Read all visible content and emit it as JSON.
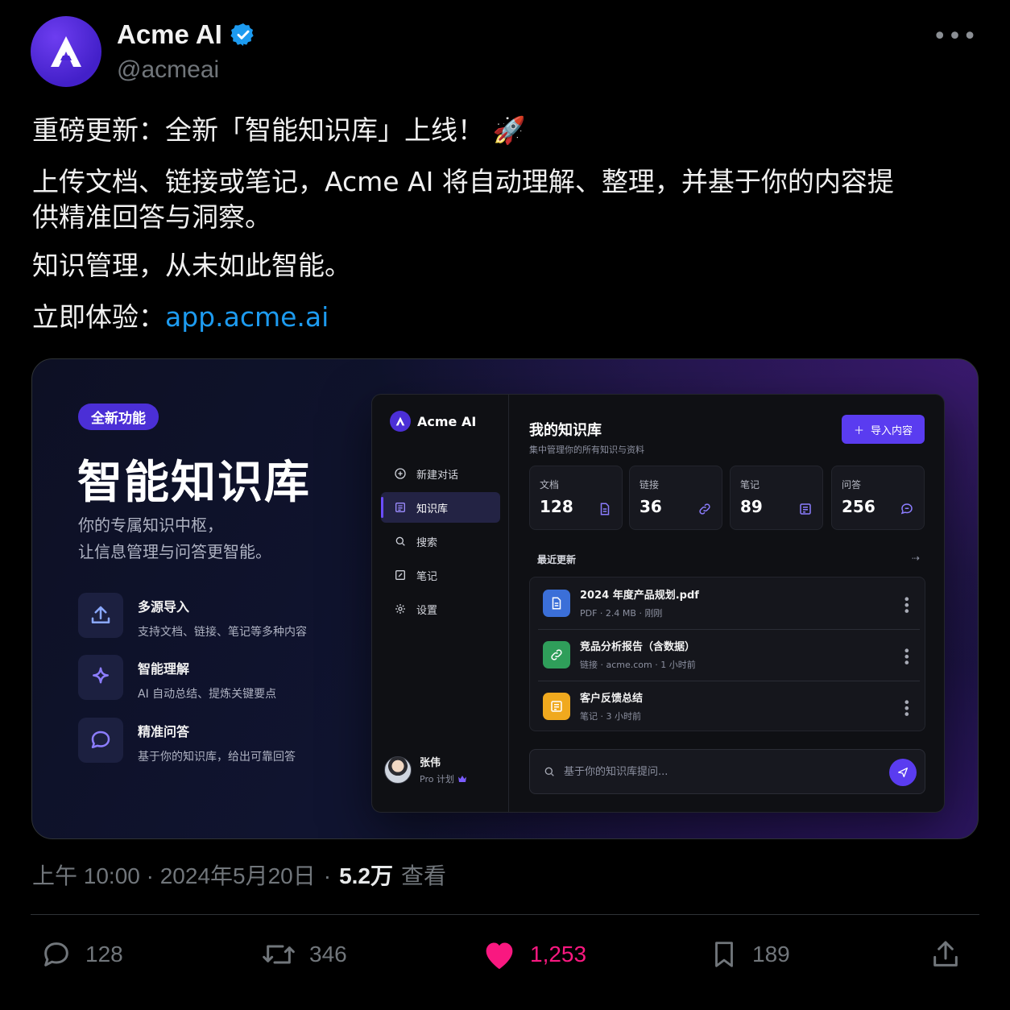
{
  "tweet": {
    "author": {
      "name": "Acme AI",
      "handle": "@acmeai",
      "verified": true
    },
    "text": {
      "line1": "重磅更新：全新「智能知识库」上线！ 🚀",
      "line2": "上传文档、链接或笔记，Acme AI 将自动理解、整理，并基于你的内容提供精准回答与洞察。",
      "line3": "知识管理，从未如此智能。",
      "line4_prefix": "立即体验：",
      "link": "app.acme.ai"
    },
    "media": {
      "badge": "全新功能",
      "title": "智能知识库",
      "subtitle_line1": "你的专属知识中枢，",
      "subtitle_line2": "让信息管理与问答更智能。",
      "features": [
        {
          "icon": "upload-icon",
          "title": "多源导入",
          "desc": "支持文档、链接、笔记等多种内容"
        },
        {
          "icon": "sparkle-icon",
          "title": "智能理解",
          "desc": "AI 自动总结、提炼关键要点"
        },
        {
          "icon": "chat-bubble-icon",
          "title": "精准问答",
          "desc": "基于你的知识库，给出可靠回答"
        }
      ],
      "app": {
        "logo": "Acme AI",
        "nav": [
          {
            "icon": "plus-circle-icon",
            "label": "新建对话"
          },
          {
            "icon": "book-icon",
            "label": "知识库",
            "active": true
          },
          {
            "icon": "search-icon",
            "label": "搜索"
          },
          {
            "icon": "edit-icon",
            "label": "笔记"
          },
          {
            "icon": "gear-icon",
            "label": "设置"
          }
        ],
        "user": {
          "name": "张伟",
          "plan": "Pro 计划"
        },
        "title": "我的知识库",
        "subtitle": "集中管理你的所有知识与资料",
        "import_button": "导入内容",
        "stats": [
          {
            "label": "文档",
            "value": "128",
            "icon": "document-icon"
          },
          {
            "label": "链接",
            "value": "36",
            "icon": "link-icon"
          },
          {
            "label": "笔记",
            "value": "89",
            "icon": "note-icon"
          },
          {
            "label": "问答",
            "value": "256",
            "icon": "chat-icon"
          }
        ],
        "recent_header": "最近更新",
        "recent": [
          {
            "name": "2024 年度产品规划.pdf",
            "meta": "PDF · 2.4 MB · 刚刚",
            "icon": "document-icon",
            "color": "#3b6fd8"
          },
          {
            "name": "竞品分析报告（含数据）",
            "meta": "链接 · acme.com · 1 小时前",
            "icon": "link-icon",
            "color": "#2f9e5a"
          },
          {
            "name": "客户反馈总结",
            "meta": "笔记 · 3 小时前",
            "icon": "note-icon",
            "color": "#f0a91e"
          }
        ],
        "ask_placeholder": "基于你的知识库提问..."
      }
    },
    "timestamp": "上午 10:00 · 2024年5月20日",
    "views_count": "5.2万",
    "views_label": "查看",
    "stats": {
      "replies": "128",
      "retweets": "346",
      "likes": "1,253",
      "bookmarks": "189"
    },
    "colors": {
      "link": "#1d9bf0",
      "like": "#f91880",
      "accent": "#5a3cf0",
      "verified": "#1d9bf0"
    }
  }
}
